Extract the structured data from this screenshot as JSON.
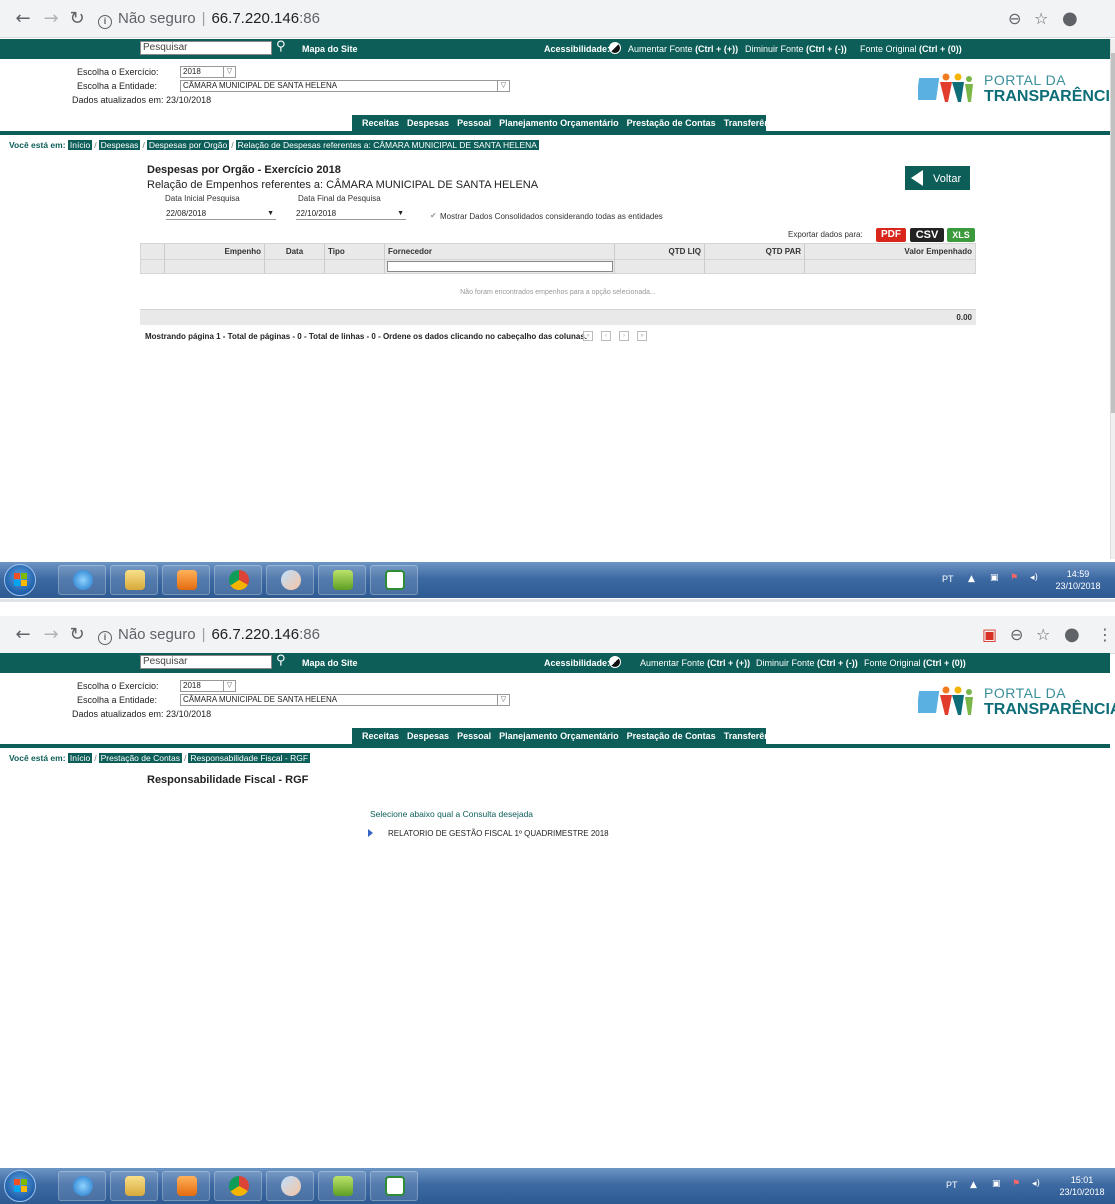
{
  "browser": {
    "not_secure": "Não seguro",
    "host": "66.7.220.146",
    "port": ":86"
  },
  "site": {
    "search_placeholder": "Pesquisar",
    "sitemap": "Mapa do Site",
    "accessibility": "Acessibilidade:",
    "font_increase": "Aumentar Fonte",
    "font_increase_key": "(Ctrl + (+))",
    "font_decrease": "Diminuir Fonte",
    "font_decrease_key": "(Ctrl + (-))",
    "font_original": "Fonte Original",
    "font_original_key": "(Ctrl + (0))",
    "year_label": "Escolha o Exercício:",
    "year_value": "2018",
    "entity_label": "Escolha a Entidade:",
    "entity_value": "CÂMARA MUNICIPAL DE SANTA HELENA",
    "updated": "Dados atualizados em: 23/10/2018",
    "logo_portal": "PORTAL DA",
    "logo_transp": "TRANSPARÊNCIA",
    "menu": [
      "Receitas",
      "Despesas",
      "Pessoal",
      "Planejamento Orçamentário",
      "Prestação de Contas",
      "Transferências"
    ],
    "crumb_prefix": "Você está em:"
  },
  "page1": {
    "crumbs": [
      "Início",
      "Despesas",
      "Despesas por Orgão",
      "Relação de Despesas referentes a: CÂMARA MUNICIPAL DE SANTA HELENA"
    ],
    "title": "Despesas por Orgão - Exercício 2018",
    "subtitle": "Relação de Empenhos referentes a: CÂMARA MUNICIPAL DE SANTA HELENA",
    "date_start_label": "Data Inicial Pesquisa",
    "date_end_label": "Data Final da Pesquisa",
    "date_start": "22/08/2018",
    "date_end": "22/10/2018",
    "consolidated": "Mostrar Dados Consolidados considerando todas as entidades",
    "back": "Voltar",
    "export_label": "Exportar dados para:",
    "export_pdf": "PDF",
    "export_csv": "CSV",
    "export_xls": "XLS",
    "columns": [
      "Empenho",
      "Data",
      "Tipo",
      "Fornecedor",
      "QTD LIQ",
      "QTD PAR",
      "Valor Empenhado"
    ],
    "empty": "Não foram encontrados empenhos para a opção selecionada...",
    "total": "0.00",
    "pager": "Mostrando página 1 - Total de páginas - 0 - Total de linhas - 0 - Ordene os dados clicando no cabeçalho das colunas."
  },
  "page2": {
    "crumbs": [
      "Início",
      "Prestação de Contas",
      "Responsabilidade Fiscal - RGF"
    ],
    "title": "Responsabilidade Fiscal - RGF",
    "select_prompt": "Selecione abaixo qual a Consulta desejada",
    "report_link": "RELATORIO DE GESTÃO FISCAL 1º QUADRIMESTRE 2018"
  },
  "taskbar": {
    "lang": "PT",
    "time1": "14:59",
    "date1": "23/10/2018",
    "time2": "15:01",
    "date2": "23/10/2018"
  }
}
